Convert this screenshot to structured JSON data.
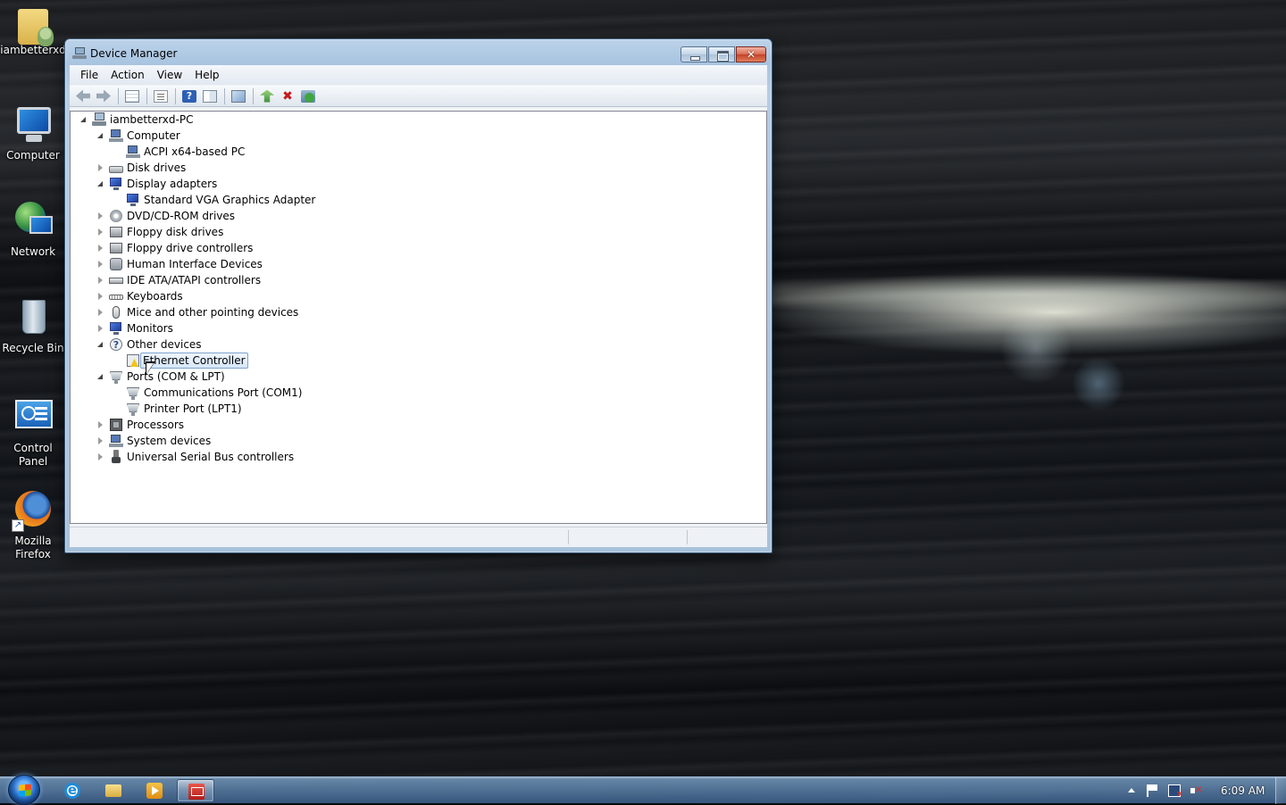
{
  "desktop": {
    "icons": [
      {
        "label": "iambetterxd",
        "icon": "user-folder-icon"
      },
      {
        "label": "Computer",
        "icon": "computer-icon"
      },
      {
        "label": "Network",
        "icon": "network-icon"
      },
      {
        "label": "Recycle Bin",
        "icon": "recycle-bin-icon"
      },
      {
        "label": "Control Panel",
        "icon": "control-panel-icon"
      },
      {
        "label": "Mozilla Firefox",
        "icon": "firefox-icon"
      }
    ]
  },
  "window": {
    "title": "Device Manager",
    "menu": [
      "File",
      "Action",
      "View",
      "Help"
    ],
    "toolbar": [
      "back-icon",
      "forward-icon",
      "show-hide-console-tree-icon",
      "properties-icon",
      "help-icon",
      "action-pane-icon",
      "scan-hardware-icon",
      "update-driver-icon",
      "uninstall-icon",
      "enable-device-icon"
    ],
    "tree": {
      "root": "iambetterxd-PC",
      "categories": [
        {
          "label": "Computer",
          "expanded": true,
          "icon": "computer-icon",
          "children": [
            "ACPI x64-based PC"
          ]
        },
        {
          "label": "Disk drives",
          "expanded": false,
          "icon": "disk-drive-icon"
        },
        {
          "label": "Display adapters",
          "expanded": true,
          "icon": "display-adapter-icon",
          "children": [
            "Standard VGA Graphics Adapter"
          ]
        },
        {
          "label": "DVD/CD-ROM drives",
          "expanded": false,
          "icon": "dvd-drive-icon"
        },
        {
          "label": "Floppy disk drives",
          "expanded": false,
          "icon": "floppy-drive-icon"
        },
        {
          "label": "Floppy drive controllers",
          "expanded": false,
          "icon": "floppy-controller-icon"
        },
        {
          "label": "Human Interface Devices",
          "expanded": false,
          "icon": "hid-icon"
        },
        {
          "label": "IDE ATA/ATAPI controllers",
          "expanded": false,
          "icon": "ide-controller-icon"
        },
        {
          "label": "Keyboards",
          "expanded": false,
          "icon": "keyboard-icon"
        },
        {
          "label": "Mice and other pointing devices",
          "expanded": false,
          "icon": "mouse-icon"
        },
        {
          "label": "Monitors",
          "expanded": false,
          "icon": "monitor-icon"
        },
        {
          "label": "Other devices",
          "expanded": true,
          "icon": "unknown-device-icon",
          "children": [
            "Ethernet Controller"
          ]
        },
        {
          "label": "Ports (COM & LPT)",
          "expanded": true,
          "icon": "port-icon",
          "children": [
            "Communications Port (COM1)",
            "Printer Port (LPT1)"
          ]
        },
        {
          "label": "Processors",
          "expanded": false,
          "icon": "processor-icon"
        },
        {
          "label": "System devices",
          "expanded": false,
          "icon": "system-device-icon"
        },
        {
          "label": "Universal Serial Bus controllers",
          "expanded": false,
          "icon": "usb-icon"
        }
      ],
      "selected": "Ethernet Controller"
    }
  },
  "taskbar": {
    "apps": [
      "internet-explorer-icon",
      "windows-explorer-icon",
      "media-player-icon",
      "device-manager-icon"
    ],
    "active_app": "device-manager-icon",
    "clock": "6:09 AM"
  }
}
